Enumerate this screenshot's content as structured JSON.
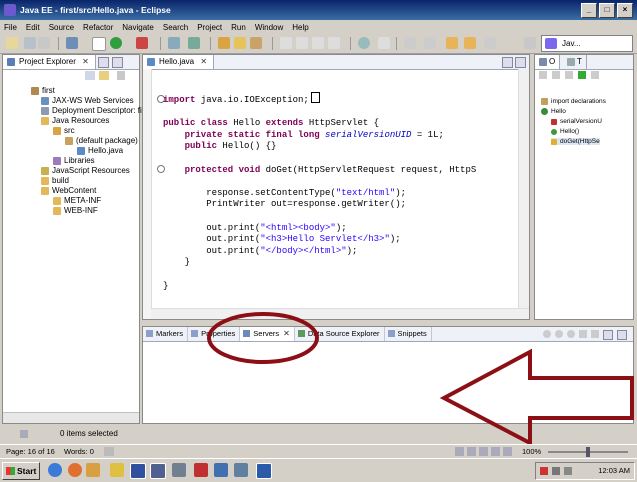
{
  "window": {
    "title": "Java EE - first/src/Hello.java - Eclipse"
  },
  "menu": [
    "File",
    "Edit",
    "Source",
    "Refactor",
    "Navigate",
    "Search",
    "Project",
    "Run",
    "Window",
    "Help"
  ],
  "perspective": {
    "label": "Jav..."
  },
  "project_explorer": {
    "tab_label": "Project Explorer",
    "tree": [
      {
        "label": "first",
        "icon": "project-icon"
      },
      {
        "label": "JAX-WS Web Services",
        "icon": "webservice-icon"
      },
      {
        "label": "Deployment Descriptor: first",
        "icon": "descriptor-icon"
      },
      {
        "label": "Java Resources",
        "icon": "folder-icon"
      },
      {
        "label": "src",
        "icon": "package-folder-icon"
      },
      {
        "label": "(default package)",
        "icon": "package-icon"
      },
      {
        "label": "Hello.java",
        "icon": "java-file-icon"
      },
      {
        "label": "Libraries",
        "icon": "library-icon"
      },
      {
        "label": "JavaScript Resources",
        "icon": "js-icon"
      },
      {
        "label": "build",
        "icon": "folder-icon"
      },
      {
        "label": "WebContent",
        "icon": "folder-icon"
      },
      {
        "label": "META-INF",
        "icon": "folder-icon"
      },
      {
        "label": "WEB-INF",
        "icon": "folder-icon"
      }
    ]
  },
  "editor": {
    "tab_label": "Hello.java",
    "code": {
      "l1_kw": "import",
      "l1_rest": " java.io.IOException;",
      "l2_kw1": "public class",
      "l2_mid": " Hello ",
      "l2_kw2": "extends",
      "l2_rest": " HttpServlet {",
      "l3_kw": "    private static final long",
      "l3_field": " serialVersionUID",
      "l3_rest": " = 1L;",
      "l4_kw": "    public",
      "l4_rest": " Hello() {}",
      "l5_kw": "    protected void",
      "l5_rest": " doGet(HttpServletRequest request, HttpS",
      "l6_pre": "        response.setContentType(",
      "l6_str": "\"text/html\"",
      "l6_post": ");",
      "l7": "        PrintWriter out=response.getWriter();",
      "l8_pre": "        out.print(",
      "l8_str": "\"<html><body>\"",
      "l8_post": ");",
      "l9_pre": "        out.print(",
      "l9_str": "\"<h3>Hello Servlet</h3>\"",
      "l9_post": ");",
      "l10_pre": "        out.print(",
      "l10_str": "\"</body></html>\"",
      "l10_post": ");",
      "l11": "    }",
      "l12": "}"
    }
  },
  "outline": {
    "tab_labels": [
      "O",
      "T"
    ],
    "tree": [
      {
        "label": "import declarations"
      },
      {
        "label": "Hello"
      },
      {
        "label": "serialVersionU"
      },
      {
        "label": "Hello()"
      },
      {
        "label": "doGet(HttpSe"
      }
    ]
  },
  "bottom_panel": {
    "tabs": [
      "Markers",
      "Properties",
      "Servers",
      "Data Source Explorer",
      "Snippets"
    ],
    "active_tab": "Servers"
  },
  "status": {
    "left": "0 items selected",
    "page": "Page: 16 of 16",
    "words": "Words: 0",
    "zoom": "100%"
  },
  "taskbar": {
    "start_label": "Start",
    "clock": "12:03 AM"
  },
  "colors": {
    "annotation": "#8b0f14",
    "titlebar": "#0a246a"
  }
}
